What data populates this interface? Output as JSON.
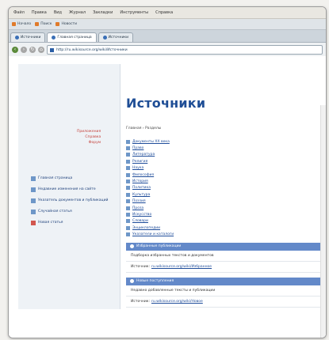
{
  "menubar": [
    "Файл",
    "Правка",
    "Вид",
    "Журнал",
    "Закладки",
    "Инструменты",
    "Справка"
  ],
  "bookmarks": [
    "Начало",
    "Поиск",
    "Новости"
  ],
  "tabs": [
    "Источники",
    "Главная страница",
    "Источники"
  ],
  "urlbar": {
    "url": "http://ru.wikisource.org/wiki/Источники"
  },
  "sidebar": {
    "red_links": [
      "Приложения",
      "Справка",
      "Форум"
    ],
    "nav": [
      {
        "label": "Главная страница"
      },
      {
        "label": "Недавние изменения на сайте"
      },
      {
        "label": "Указатель документов и публикаций"
      },
      {
        "label": "Случайная статья"
      },
      {
        "label": "Новая статья"
      }
    ]
  },
  "main": {
    "title": "Источники",
    "breadcrumb": "Главная › Разделы",
    "links": [
      "Документы XX века",
      "Право",
      "Литература",
      "Религия",
      "Наука",
      "Философия",
      "История",
      "Политика",
      "Культура",
      "Поэзия",
      "Проза",
      "Искусство",
      "Словари",
      "Энциклопедии",
      "Указатели и каталоги"
    ],
    "sections": [
      {
        "heading": "Избранные публикации",
        "desc": "Подборка избранных текстов и документов",
        "label": "Источник:",
        "link": "ru.wikisource.org/wiki/Избранное"
      },
      {
        "heading": "Новые поступления",
        "desc": "Недавно добавленные тексты и публикации",
        "label": "Источник:",
        "link": "ru.wikisource.org/wiki/Новое"
      }
    ]
  }
}
